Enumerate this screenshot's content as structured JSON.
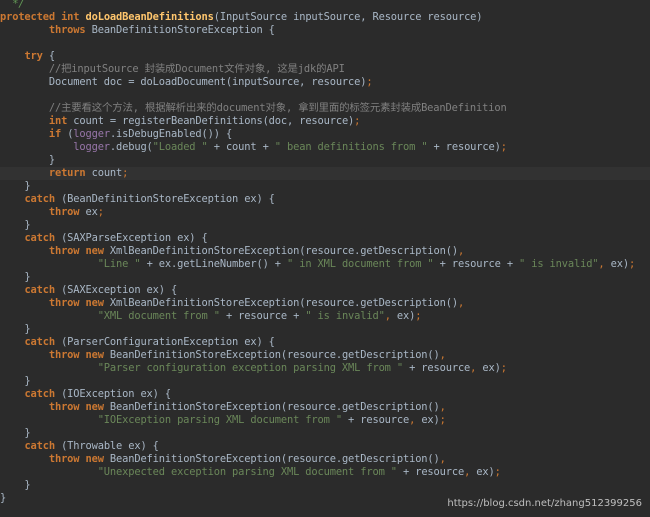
{
  "editor": {
    "theme_colors": {
      "background": "#2b2b2b",
      "keyword": "#cc7832",
      "method": "#ffc66d",
      "string": "#6a8759",
      "comment": "#808080",
      "field": "#9876aa",
      "text": "#a9b7c6"
    },
    "lines": [
      [
        {
          "t": "  ",
          "c": "plain"
        },
        {
          "t": "*/",
          "c": "doc"
        }
      ],
      [
        {
          "t": "protected ",
          "c": "kw"
        },
        {
          "t": "int ",
          "c": "kw"
        },
        {
          "t": "doLoadBeanDefinitions",
          "c": "fn"
        },
        {
          "t": "(InputSource inputSource, Resource resource)",
          "c": "plain"
        }
      ],
      [
        {
          "t": "        ",
          "c": "plain"
        },
        {
          "t": "throws ",
          "c": "kw"
        },
        {
          "t": "BeanDefinitionStoreException {",
          "c": "plain"
        }
      ],
      [],
      [
        {
          "t": "    ",
          "c": "plain"
        },
        {
          "t": "try ",
          "c": "kw"
        },
        {
          "t": "{",
          "c": "plain"
        }
      ],
      [
        {
          "t": "        ",
          "c": "plain"
        },
        {
          "t": "//把inputSource 封装成Document文件对象, 这是jdk的API",
          "c": "cm"
        }
      ],
      [
        {
          "t": "        Document doc = doLoadDocument(inputSource, resource)",
          "c": "plain"
        },
        {
          "t": ";",
          "c": "kwn"
        }
      ],
      [],
      [
        {
          "t": "        ",
          "c": "plain"
        },
        {
          "t": "//主要看这个方法, 根据解析出来的document对象, 拿到里面的标签元素封装成BeanDefinition",
          "c": "cm"
        }
      ],
      [
        {
          "t": "        ",
          "c": "plain"
        },
        {
          "t": "int ",
          "c": "kw"
        },
        {
          "t": "count = registerBeanDefinitions(doc, resource)",
          "c": "plain"
        },
        {
          "t": ";",
          "c": "kwn"
        }
      ],
      [
        {
          "t": "        ",
          "c": "plain"
        },
        {
          "t": "if ",
          "c": "kw"
        },
        {
          "t": "(",
          "c": "plain"
        },
        {
          "t": "logger",
          "c": "fld"
        },
        {
          "t": ".isDebugEnabled()) {",
          "c": "plain"
        }
      ],
      [
        {
          "t": "            ",
          "c": "plain"
        },
        {
          "t": "logger",
          "c": "fld"
        },
        {
          "t": ".debug(",
          "c": "plain"
        },
        {
          "t": "\"Loaded \" ",
          "c": "str"
        },
        {
          "t": "+ count + ",
          "c": "plain"
        },
        {
          "t": "\" bean definitions from \" ",
          "c": "str"
        },
        {
          "t": "+ resource)",
          "c": "plain"
        },
        {
          "t": ";",
          "c": "kwn"
        }
      ],
      [
        {
          "t": "        }",
          "c": "plain"
        }
      ],
      [
        {
          "t": "        ",
          "c": "plain"
        },
        {
          "t": "return ",
          "c": "kw"
        },
        {
          "t": "count",
          "c": "plain"
        },
        {
          "t": ";",
          "c": "kwn"
        }
      ],
      [
        {
          "t": "    }",
          "c": "plain"
        }
      ],
      [
        {
          "t": "    ",
          "c": "plain"
        },
        {
          "t": "catch ",
          "c": "kw"
        },
        {
          "t": "(BeanDefinitionStoreException ex) {",
          "c": "plain"
        }
      ],
      [
        {
          "t": "        ",
          "c": "plain"
        },
        {
          "t": "throw ",
          "c": "kw"
        },
        {
          "t": "ex",
          "c": "plain"
        },
        {
          "t": ";",
          "c": "kwn"
        }
      ],
      [
        {
          "t": "    }",
          "c": "plain"
        }
      ],
      [
        {
          "t": "    ",
          "c": "plain"
        },
        {
          "t": "catch ",
          "c": "kw"
        },
        {
          "t": "(SAXParseException ex) {",
          "c": "plain"
        }
      ],
      [
        {
          "t": "        ",
          "c": "plain"
        },
        {
          "t": "throw new ",
          "c": "kw"
        },
        {
          "t": "XmlBeanDefinitionStoreException(resource.getDescription()",
          "c": "plain"
        },
        {
          "t": ",",
          "c": "kwn"
        }
      ],
      [
        {
          "t": "                ",
          "c": "plain"
        },
        {
          "t": "\"Line \" ",
          "c": "str"
        },
        {
          "t": "+ ex.getLineNumber() + ",
          "c": "plain"
        },
        {
          "t": "\" in XML document from \" ",
          "c": "str"
        },
        {
          "t": "+ resource + ",
          "c": "plain"
        },
        {
          "t": "\" is invalid\"",
          "c": "str"
        },
        {
          "t": ", ",
          "c": "kwn"
        },
        {
          "t": "ex)",
          "c": "plain"
        },
        {
          "t": ";",
          "c": "kwn"
        }
      ],
      [
        {
          "t": "    }",
          "c": "plain"
        }
      ],
      [
        {
          "t": "    ",
          "c": "plain"
        },
        {
          "t": "catch ",
          "c": "kw"
        },
        {
          "t": "(SAXException ex) {",
          "c": "plain"
        }
      ],
      [
        {
          "t": "        ",
          "c": "plain"
        },
        {
          "t": "throw new ",
          "c": "kw"
        },
        {
          "t": "XmlBeanDefinitionStoreException(resource.getDescription()",
          "c": "plain"
        },
        {
          "t": ",",
          "c": "kwn"
        }
      ],
      [
        {
          "t": "                ",
          "c": "plain"
        },
        {
          "t": "\"XML document from \" ",
          "c": "str"
        },
        {
          "t": "+ resource + ",
          "c": "plain"
        },
        {
          "t": "\" is invalid\"",
          "c": "str"
        },
        {
          "t": ", ",
          "c": "kwn"
        },
        {
          "t": "ex)",
          "c": "plain"
        },
        {
          "t": ";",
          "c": "kwn"
        }
      ],
      [
        {
          "t": "    }",
          "c": "plain"
        }
      ],
      [
        {
          "t": "    ",
          "c": "plain"
        },
        {
          "t": "catch ",
          "c": "kw"
        },
        {
          "t": "(ParserConfigurationException ex) {",
          "c": "plain"
        }
      ],
      [
        {
          "t": "        ",
          "c": "plain"
        },
        {
          "t": "throw new ",
          "c": "kw"
        },
        {
          "t": "BeanDefinitionStoreException(resource.getDescription()",
          "c": "plain"
        },
        {
          "t": ",",
          "c": "kwn"
        }
      ],
      [
        {
          "t": "                ",
          "c": "plain"
        },
        {
          "t": "\"Parser configuration exception parsing XML from \" ",
          "c": "str"
        },
        {
          "t": "+ resource",
          "c": "plain"
        },
        {
          "t": ", ",
          "c": "kwn"
        },
        {
          "t": "ex)",
          "c": "plain"
        },
        {
          "t": ";",
          "c": "kwn"
        }
      ],
      [
        {
          "t": "    }",
          "c": "plain"
        }
      ],
      [
        {
          "t": "    ",
          "c": "plain"
        },
        {
          "t": "catch ",
          "c": "kw"
        },
        {
          "t": "(IOException ex) {",
          "c": "plain"
        }
      ],
      [
        {
          "t": "        ",
          "c": "plain"
        },
        {
          "t": "throw new ",
          "c": "kw"
        },
        {
          "t": "BeanDefinitionStoreException(resource.getDescription()",
          "c": "plain"
        },
        {
          "t": ",",
          "c": "kwn"
        }
      ],
      [
        {
          "t": "                ",
          "c": "plain"
        },
        {
          "t": "\"IOException parsing XML document from \" ",
          "c": "str"
        },
        {
          "t": "+ resource",
          "c": "plain"
        },
        {
          "t": ", ",
          "c": "kwn"
        },
        {
          "t": "ex)",
          "c": "plain"
        },
        {
          "t": ";",
          "c": "kwn"
        }
      ],
      [
        {
          "t": "    }",
          "c": "plain"
        }
      ],
      [
        {
          "t": "    ",
          "c": "plain"
        },
        {
          "t": "catch ",
          "c": "kw"
        },
        {
          "t": "(Throwable ex) {",
          "c": "plain"
        }
      ],
      [
        {
          "t": "        ",
          "c": "plain"
        },
        {
          "t": "throw new ",
          "c": "kw"
        },
        {
          "t": "BeanDefinitionStoreException(resource.getDescription()",
          "c": "plain"
        },
        {
          "t": ",",
          "c": "kwn"
        }
      ],
      [
        {
          "t": "                ",
          "c": "plain"
        },
        {
          "t": "\"Unexpected exception parsing XML document from \" ",
          "c": "str"
        },
        {
          "t": "+ resource",
          "c": "plain"
        },
        {
          "t": ", ",
          "c": "kwn"
        },
        {
          "t": "ex)",
          "c": "plain"
        },
        {
          "t": ";",
          "c": "kwn"
        }
      ],
      [
        {
          "t": "    }",
          "c": "plain"
        }
      ],
      [
        {
          "t": "}",
          "c": "plain"
        }
      ]
    ],
    "active_line": 13
  },
  "watermark": {
    "text": "https://blog.csdn.net/zhang512399256"
  }
}
